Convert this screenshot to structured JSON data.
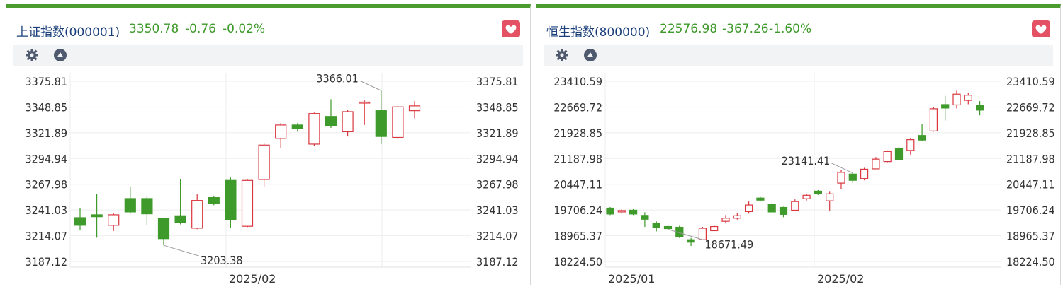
{
  "panels": [
    {
      "title": "上证指数(000001)",
      "price": "3350.78",
      "change": "-0.76",
      "change_pct": "-0.02%"
    },
    {
      "title": "恒生指数(800000)",
      "price": "22576.98",
      "change": "-367.26",
      "change_pct": "-1.60%"
    }
  ],
  "icons": [
    "gear-icon",
    "triangle-up-icon",
    "heart-icon"
  ],
  "colors": {
    "up": "#d9363e",
    "down": "#3e9a2a",
    "accent": "#4b9b2e",
    "title": "#1a3f7a",
    "favorite": "#e45064"
  },
  "chart_data": [
    {
      "type": "candlestick",
      "y_ticks": [
        "3375.81",
        "3348.85",
        "3321.89",
        "3294.94",
        "3267.98",
        "3241.03",
        "3214.07",
        "3187.12"
      ],
      "ylim": [
        3187.12,
        3375.81
      ],
      "x_labels": [
        {
          "index": 9,
          "label": "2025/02"
        }
      ],
      "annotations": [
        {
          "index": 18,
          "label": "3366.01",
          "type": "high"
        },
        {
          "index": 5,
          "label": "3203.38",
          "type": "low"
        }
      ],
      "candles": [
        {
          "o": 3233,
          "c": 3225,
          "h": 3243,
          "l": 3220
        },
        {
          "o": 3236,
          "c": 3234,
          "h": 3258,
          "l": 3212
        },
        {
          "o": 3225,
          "c": 3236,
          "h": 3238,
          "l": 3219
        },
        {
          "o": 3253,
          "c": 3239,
          "h": 3265,
          "l": 3237
        },
        {
          "o": 3253,
          "c": 3237,
          "h": 3256,
          "l": 3225
        },
        {
          "o": 3232,
          "c": 3211,
          "h": 3233,
          "l": 3204
        },
        {
          "o": 3235,
          "c": 3228,
          "h": 3273,
          "l": 3226
        },
        {
          "o": 3222,
          "c": 3251,
          "h": 3258,
          "l": 3221
        },
        {
          "o": 3254,
          "c": 3248,
          "h": 3256,
          "l": 3246
        },
        {
          "o": 3272,
          "c": 3231,
          "h": 3275,
          "l": 3222
        },
        {
          "o": 3224,
          "c": 3272,
          "h": 3273,
          "l": 3223
        },
        {
          "o": 3273,
          "c": 3309,
          "h": 3311,
          "l": 3265
        },
        {
          "o": 3316,
          "c": 3330,
          "h": 3332,
          "l": 3306
        },
        {
          "o": 3330,
          "c": 3326,
          "h": 3332,
          "l": 3323
        },
        {
          "o": 3310,
          "c": 3342,
          "h": 3343,
          "l": 3308
        },
        {
          "o": 3339,
          "c": 3329,
          "h": 3357,
          "l": 3327
        },
        {
          "o": 3323,
          "c": 3344,
          "h": 3346,
          "l": 3318
        },
        {
          "o": 3354,
          "c": 3354,
          "h": 3356,
          "l": 3330
        },
        {
          "o": 3345,
          "c": 3318,
          "h": 3366,
          "l": 3310
        },
        {
          "o": 3317,
          "c": 3349,
          "h": 3350,
          "l": 3315
        },
        {
          "o": 3345,
          "c": 3350,
          "h": 3355,
          "l": 3337
        }
      ]
    },
    {
      "type": "candlestick",
      "y_ticks": [
        "23410.59",
        "22669.72",
        "21928.85",
        "21187.98",
        "20447.11",
        "19706.24",
        "18965.37",
        "18224.50"
      ],
      "ylim": [
        18224.5,
        23410.59
      ],
      "x_labels": [
        {
          "index": 2,
          "label": "2025/01"
        },
        {
          "index": 14,
          "label": "2025/02"
        }
      ],
      "annotations": [
        {
          "index": 21,
          "label": "23141.41",
          "type": "high"
        },
        {
          "index": 5,
          "label": "18671.49",
          "type": "low"
        }
      ],
      "candles": [
        {
          "o": 19760,
          "c": 19590,
          "h": 19790,
          "l": 19560
        },
        {
          "o": 19650,
          "c": 19690,
          "h": 19730,
          "l": 19600
        },
        {
          "o": 19700,
          "c": 19590,
          "h": 19730,
          "l": 19560
        },
        {
          "o": 19550,
          "c": 19440,
          "h": 19640,
          "l": 19220
        },
        {
          "o": 19320,
          "c": 19200,
          "h": 19380,
          "l": 19090
        },
        {
          "o": 19230,
          "c": 19170,
          "h": 19270,
          "l": 19150
        },
        {
          "o": 19210,
          "c": 18930,
          "h": 19250,
          "l": 18900
        },
        {
          "o": 18850,
          "c": 18780,
          "h": 18900,
          "l": 18671
        },
        {
          "o": 18850,
          "c": 19180,
          "h": 19220,
          "l": 18840
        },
        {
          "o": 19110,
          "c": 19230,
          "h": 19270,
          "l": 19100
        },
        {
          "o": 19380,
          "c": 19470,
          "h": 19560,
          "l": 19320
        },
        {
          "o": 19470,
          "c": 19540,
          "h": 19610,
          "l": 19430
        },
        {
          "o": 19660,
          "c": 19850,
          "h": 19950,
          "l": 19600
        },
        {
          "o": 20050,
          "c": 19990,
          "h": 20080,
          "l": 19950
        },
        {
          "o": 19880,
          "c": 19650,
          "h": 19900,
          "l": 19640
        },
        {
          "o": 19780,
          "c": 19580,
          "h": 19800,
          "l": 19500
        },
        {
          "o": 19700,
          "c": 19950,
          "h": 20010,
          "l": 19680
        },
        {
          "o": 20030,
          "c": 20130,
          "h": 20170,
          "l": 19980
        },
        {
          "o": 20250,
          "c": 20170,
          "h": 20280,
          "l": 20140
        },
        {
          "o": 19970,
          "c": 20170,
          "h": 20230,
          "l": 19680
        },
        {
          "o": 20480,
          "c": 20790,
          "h": 20860,
          "l": 20300
        },
        {
          "o": 20740,
          "c": 20560,
          "h": 20770,
          "l": 20480
        },
        {
          "o": 20610,
          "c": 20880,
          "h": 20920,
          "l": 20560
        },
        {
          "o": 20890,
          "c": 21170,
          "h": 21230,
          "l": 20880
        },
        {
          "o": 21100,
          "c": 21390,
          "h": 21420,
          "l": 21080
        },
        {
          "o": 21480,
          "c": 21160,
          "h": 21520,
          "l": 21130
        },
        {
          "o": 21420,
          "c": 21730,
          "h": 21760,
          "l": 21300
        },
        {
          "o": 21850,
          "c": 21720,
          "h": 22190,
          "l": 21690
        },
        {
          "o": 21980,
          "c": 22620,
          "h": 22660,
          "l": 21960
        },
        {
          "o": 22740,
          "c": 22640,
          "h": 22990,
          "l": 22280
        },
        {
          "o": 22730,
          "c": 23040,
          "h": 23141,
          "l": 22630
        },
        {
          "o": 22860,
          "c": 23010,
          "h": 23070,
          "l": 22750
        },
        {
          "o": 22710,
          "c": 22580,
          "h": 22840,
          "l": 22430
        }
      ]
    }
  ]
}
